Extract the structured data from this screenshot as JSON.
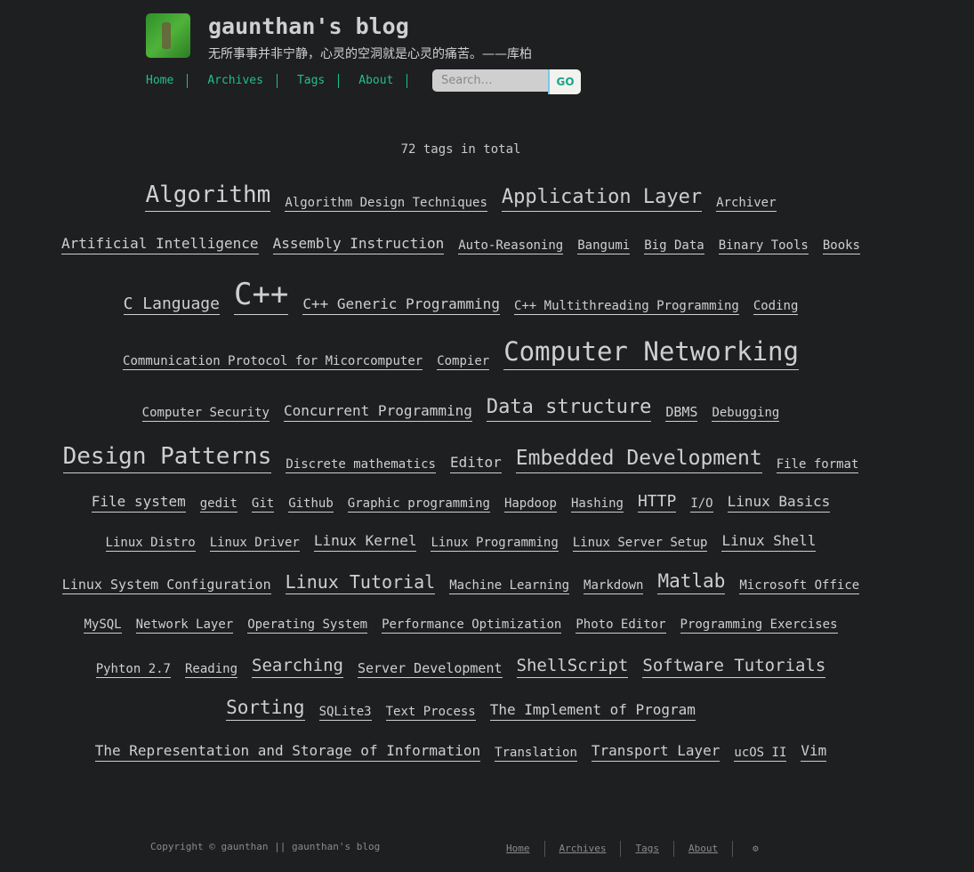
{
  "site": {
    "title": "gaunthan's blog",
    "subtitle": "无所事事并非宁静，心灵的空洞就是心灵的痛苦。——库柏"
  },
  "nav": {
    "items": [
      "Home",
      "Archives",
      "Tags",
      "About"
    ]
  },
  "search": {
    "placeholder": "Search…",
    "button": "GO"
  },
  "total": "72 tags in total",
  "tags": [
    "Algorithm",
    "Algorithm Design Techniques",
    "Application Layer",
    "Archiver",
    "Artificial Intelligence",
    "Assembly Instruction",
    "Auto-Reasoning",
    "Bangumi",
    "Big Data",
    "Binary Tools",
    "Books",
    "C Language",
    "C++",
    "C++ Generic Programming",
    "C++ Multithreading Programming",
    "Coding",
    "Communication Protocol for Micorcomputer",
    "Compier",
    "Computer Networking",
    "Computer Security",
    "Concurrent Programming",
    "Data structure",
    "DBMS",
    "Debugging",
    "Design Patterns",
    "Discrete mathematics",
    "Editor",
    "Embedded Development",
    "File format",
    "File system",
    "gedit",
    "Git",
    "Github",
    "Graphic programming",
    "Hapdoop",
    "Hashing",
    "HTTP",
    "I/O",
    "Linux Basics",
    "Linux Distro",
    "Linux Driver",
    "Linux Kernel",
    "Linux Programming",
    "Linux Server Setup",
    "Linux Shell",
    "Linux System Configuration",
    "Linux Tutorial",
    "Machine Learning",
    "Markdown",
    "Matlab",
    "Microsoft Office",
    "MySQL",
    "Network Layer",
    "Operating System",
    "Performance Optimization",
    "Photo Editor",
    "Programming Exercises",
    "Pyhton 2.7",
    "Reading",
    "Searching",
    "Server Development",
    "ShellScript",
    "Software Tutorials",
    "Sorting",
    "SQLite3",
    "Text Process",
    "The Implement of Program",
    "The Representation and Storage of Information",
    "Translation",
    "Transport Layer",
    "ucOS II",
    "Vim"
  ],
  "footer": {
    "copyright": "Copyright © gaunthan || gaunthan's blog",
    "links": [
      "Home",
      "Archives",
      "Tags",
      "About"
    ],
    "settings_icon": "gear-icon"
  }
}
